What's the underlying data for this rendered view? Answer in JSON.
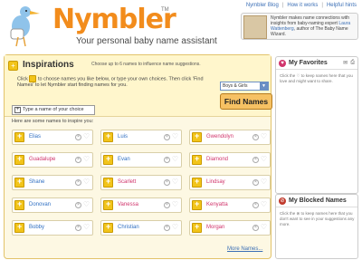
{
  "header": {
    "logo": "Nymbler",
    "tm": "TM",
    "tagline": "Your personal baby name assistant",
    "links": [
      "Nymbler Blog",
      "How it works",
      "Helpful hints"
    ],
    "promo": {
      "text_before": "Nymbler makes name connections with insights from baby-naming expert",
      "author": "Laura Wattenberg",
      "text_after": ", author of The Baby Name Wizard."
    }
  },
  "inspirations": {
    "title": "Inspirations",
    "subtitle": "Choose up to 6 names to influence name suggestions.",
    "instruction_before": "Click",
    "instruction_after": "to choose names you like below, or type your own choices. Then click 'Find Names' to let Nymbler start finding names for you.",
    "gender_select": "Boys & Girls",
    "find_button": "Find Names",
    "type_choice": "Type a name of your choice",
    "here_label": "Here are some names to inspire you:",
    "more_link": "More Names..."
  },
  "names": [
    {
      "name": "Elias",
      "gender": "boy"
    },
    {
      "name": "Luis",
      "gender": "boy"
    },
    {
      "name": "Gwendolyn",
      "gender": "girl"
    },
    {
      "name": "Guadalupe",
      "gender": "girl"
    },
    {
      "name": "Evan",
      "gender": "boy"
    },
    {
      "name": "Diamond",
      "gender": "girl"
    },
    {
      "name": "Shane",
      "gender": "boy"
    },
    {
      "name": "Scarlett",
      "gender": "girl"
    },
    {
      "name": "Lindsay",
      "gender": "girl"
    },
    {
      "name": "Donovan",
      "gender": "boy"
    },
    {
      "name": "Vanessa",
      "gender": "girl"
    },
    {
      "name": "Kenyatta",
      "gender": "girl"
    },
    {
      "name": "Bobby",
      "gender": "boy"
    },
    {
      "name": "Christian",
      "gender": "boy"
    },
    {
      "name": "Morgan",
      "gender": "girl"
    }
  ],
  "favorites": {
    "title": "My Favorites",
    "hint": "Click the ♡ to keep names here that you love and might want to share."
  },
  "blocked": {
    "title": "My Blocked Names",
    "hint": "Click the ⊗ to keep names here that you don't want to see in your suggestions any more."
  },
  "colors": {
    "brand_orange": "#f28c1c",
    "boy_blue": "#2f6fc2",
    "girl_pink": "#d0346b",
    "panel_yellow": "#fff6cc"
  }
}
